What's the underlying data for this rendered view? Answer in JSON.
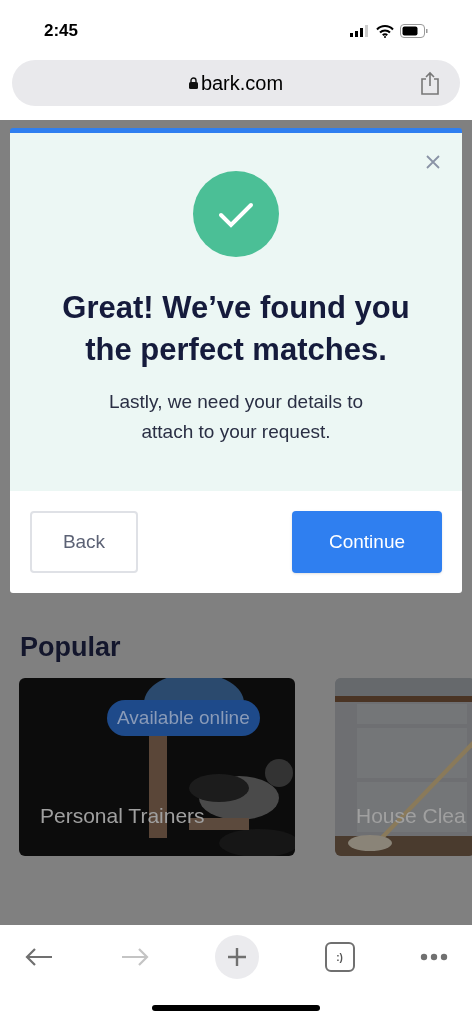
{
  "status_bar": {
    "time": "2:45"
  },
  "browser": {
    "url": "bark.com"
  },
  "modal": {
    "title": "Great! We’ve found you the perfect matches.",
    "message": "Lastly, we need your details to attach to your request.",
    "buttons": [
      {
        "label": "Back",
        "kind": "secondary"
      },
      {
        "label": "Continue",
        "kind": "primary"
      }
    ]
  },
  "popular": {
    "heading": "Popular",
    "cards": [
      {
        "label": "Personal Trainers",
        "badge": "Available online",
        "kind": "picture"
      },
      {
        "label": "House Clea",
        "kind": "picture"
      }
    ]
  },
  "toolbar": {
    "back_disabled": false,
    "forward_disabled": true,
    "tabs_label": ":)"
  }
}
